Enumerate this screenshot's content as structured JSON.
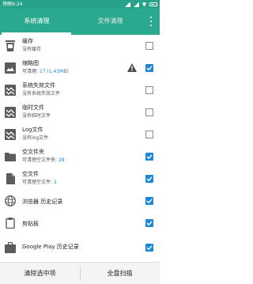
{
  "status_bar": {
    "time": "傍晚6:24"
  },
  "tabs": [
    {
      "label": "系统清理",
      "active": true
    },
    {
      "label": "文件清理",
      "active": false
    }
  ],
  "items": [
    {
      "icon": "trash-icon",
      "title": "缓存",
      "subtitle": "没有缓存",
      "checked": false,
      "warning": false
    },
    {
      "icon": "image-icon",
      "title": "缩略图",
      "subtitle_prefix": "可清理: ",
      "subtitle_value": "17 (1.43MB)",
      "checked": true,
      "warning": true
    },
    {
      "icon": "broken-image-icon",
      "title": "系统失效文件",
      "subtitle": "没有系统失效文件",
      "checked": false,
      "warning": false
    },
    {
      "icon": "broken-image-icon",
      "title": "临时文件",
      "subtitle": "没有临时文件",
      "checked": false,
      "warning": false
    },
    {
      "icon": "broken-image-icon",
      "title": "Log文件",
      "subtitle": "没有log文件",
      "checked": false,
      "warning": false
    },
    {
      "icon": "folder-icon",
      "title": "空文件夹",
      "subtitle_prefix": "可清理空文件夹: ",
      "subtitle_value": "28",
      "checked": true,
      "warning": false
    },
    {
      "icon": "file-icon",
      "title": "空文件",
      "subtitle_prefix": "可清理空文件: ",
      "subtitle_value": "2",
      "checked": true,
      "warning": false
    },
    {
      "icon": "globe-icon",
      "title": "浏览器 历史记录",
      "checked": true,
      "warning": false
    },
    {
      "icon": "clipboard-icon",
      "title": "剪贴板",
      "checked": true,
      "warning": false
    },
    {
      "icon": "briefcase-icon",
      "title": "Google Play 历史记录",
      "checked": true,
      "warning": false
    }
  ],
  "bottom_bar": {
    "clear_selected": "清除选中项",
    "full_scan": "全盘扫描"
  },
  "colors": {
    "primary": "#2ba98f",
    "status_bar": "#27a187",
    "checkbox": "#1e88d8",
    "link": "#2a86c8"
  }
}
